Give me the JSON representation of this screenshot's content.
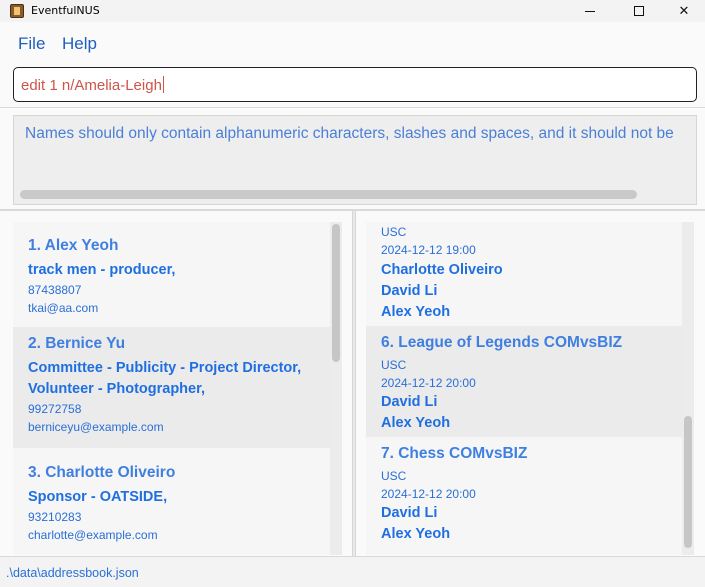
{
  "window": {
    "title": "EventfulNUS"
  },
  "menu": {
    "file": "File",
    "help": "Help"
  },
  "command": {
    "value": "edit 1 n/Amelia-Leigh"
  },
  "result": {
    "message": "Names should only contain alphanumeric characters, slashes and spaces, and it should not be"
  },
  "persons": [
    {
      "name": "1. Alex Yeoh",
      "tags": [
        "track men - producer,"
      ],
      "phone": "87438807",
      "email": "tkai@aa.com"
    },
    {
      "name": "2. Bernice Yu",
      "tags": [
        "Committee - Publicity - Project Director,",
        "Volunteer - Photographer,"
      ],
      "phone": "99272758",
      "email": "berniceyu@example.com"
    },
    {
      "name": "3. Charlotte Oliveiro",
      "tags": [
        "Sponsor - OATSIDE,"
      ],
      "phone": "93210283",
      "email": "charlotte@example.com"
    }
  ],
  "events": [
    {
      "venue": "USC",
      "datetime": "2024-12-12 19:00",
      "participants": [
        "Charlotte Oliveiro",
        "David Li",
        "Alex Yeoh"
      ]
    },
    {
      "name": "6. League of Legends COMvsBIZ",
      "venue": "USC",
      "datetime": "2024-12-12 20:00",
      "participants": [
        "David Li",
        "Alex Yeoh"
      ]
    },
    {
      "name": "7. Chess COMvsBIZ",
      "venue": "USC",
      "datetime": "2024-12-12 20:00",
      "participants": [
        "David Li",
        "Alex Yeoh"
      ]
    }
  ],
  "status": {
    "path": ".\\data\\addressbook.json"
  },
  "icons": {
    "app": "app-icon",
    "minimize": "minimize-icon",
    "maximize": "maximize-icon",
    "close": "close-icon"
  },
  "colors": {
    "accent": "#1f6fe0",
    "error": "#d0544a"
  }
}
